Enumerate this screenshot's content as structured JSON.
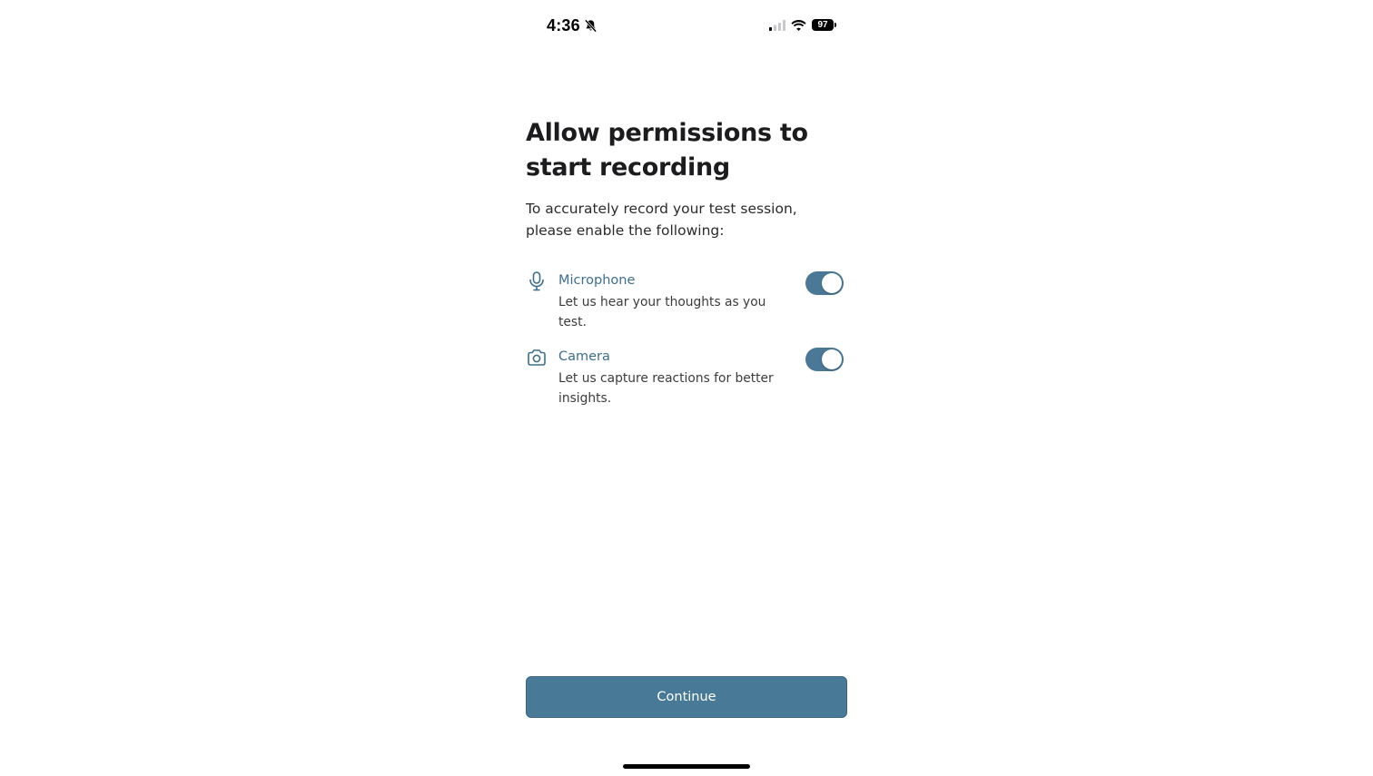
{
  "status_bar": {
    "time": "4:36",
    "battery": "97",
    "icons": [
      "bell-slash-icon",
      "cellular-signal-icon",
      "wifi-icon",
      "battery-icon"
    ]
  },
  "header": {
    "title": "Allow permissions to start recording",
    "subtitle": "To accurately record your test session, please enable the following:"
  },
  "permissions": [
    {
      "icon": "microphone-icon",
      "title": "Microphone",
      "description": "Let us hear your thoughts as you test.",
      "enabled": true
    },
    {
      "icon": "camera-icon",
      "title": "Camera",
      "description": "Let us capture reactions for better insights.",
      "enabled": true
    }
  ],
  "actions": {
    "continue_label": "Continue"
  },
  "colors": {
    "accent": "#487a98",
    "title_accent": "#3d6e8d",
    "text": "#1c1c1e",
    "background": "#ffffff"
  }
}
